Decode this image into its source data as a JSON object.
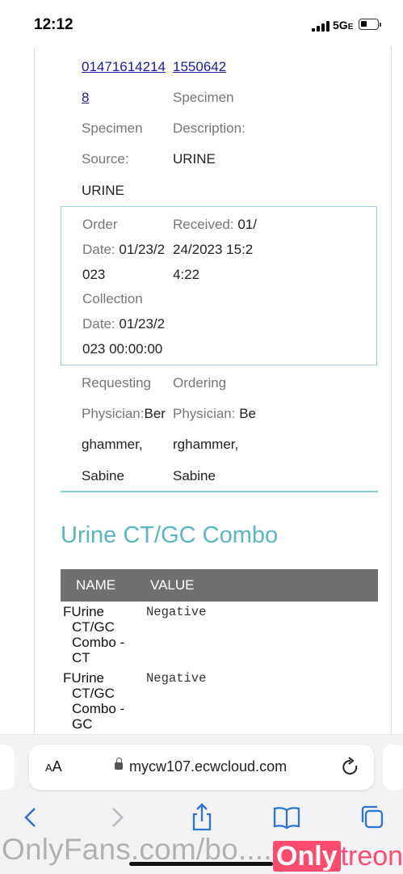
{
  "status_bar": {
    "time": "12:12",
    "network": "5G",
    "network_suffix": "E"
  },
  "record": {
    "id_left": "01471614214",
    "id_right": "1550642",
    "id_left_cont": "8",
    "specimen_label": "Specimen",
    "specimen_desc_label": "Specimen",
    "description_label": "Description:",
    "source_label": "Source:",
    "description_value": "URINE",
    "source_value": "URINE",
    "order_l1": "Order",
    "order_l2_label": "Date:",
    "order_l2_value": "01/23/2",
    "order_l3": "023",
    "collection_l1": "Collection",
    "collection_l2_label": "Date:",
    "collection_l2_value": "01/23/2",
    "collection_l3": "023 00:00:00",
    "received_label": "Received:",
    "received_value_1": "01/",
    "received_value_2": "24/2023 15:2",
    "received_value_3": "4:22",
    "requesting_l1": "Requesting",
    "requesting_l2_label": "Physician:",
    "requesting_l2_value": "Ber",
    "requesting_l3": "ghammer,",
    "requesting_l4": "Sabine",
    "ordering_l1": "Ordering",
    "ordering_l2_label": "Physician:",
    "ordering_l2_value": "Be",
    "ordering_l3": "rghammer,",
    "ordering_l4": "Sabine"
  },
  "section": {
    "title": "Urine CT/GC Combo",
    "col_name": "NAME",
    "col_value": "VALUE",
    "rows": [
      {
        "flag": "F",
        "l1": "Urine",
        "l2": "CT/GC",
        "l3": "Combo -",
        "l4": "CT",
        "value": "Negative"
      },
      {
        "flag": "F",
        "l1": "Urine",
        "l2": "CT/GC",
        "l3": "Combo -",
        "l4": "GC",
        "value": "Negative"
      }
    ]
  },
  "browser": {
    "text_size_label": "AA",
    "url": "mycw107.ecwcloud.com"
  },
  "watermark": {
    "text": "OnlyFans.com/bo.......",
    "logo_only": "Only",
    "logo_treon": "treon"
  }
}
